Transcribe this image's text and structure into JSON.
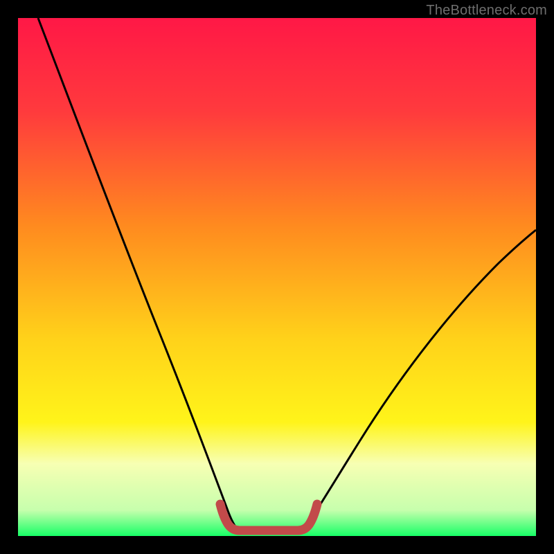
{
  "branding": {
    "watermark": "TheBottleneck.com"
  },
  "chart_data": {
    "type": "line",
    "title": "",
    "xlabel": "",
    "ylabel": "",
    "xlim": [
      0,
      100
    ],
    "ylim": [
      0,
      100
    ],
    "background_gradient": {
      "top": "#ff1846",
      "mid1": "#ff8a1f",
      "mid2": "#ffe51a",
      "band": "#f7ffb3",
      "bottom": "#17ff66"
    },
    "series": [
      {
        "name": "left-curve",
        "x": [
          4,
          8,
          12,
          16,
          20,
          24,
          28,
          32,
          36,
          40
        ],
        "values": [
          100,
          87,
          74,
          62,
          50,
          38,
          27,
          17,
          8,
          2
        ]
      },
      {
        "name": "right-curve",
        "x": [
          52,
          56,
          62,
          68,
          74,
          80,
          86,
          92,
          98,
          100
        ],
        "values": [
          2,
          7,
          14,
          22,
          30,
          38,
          45,
          52,
          58,
          60
        ]
      },
      {
        "name": "bracket",
        "x": [
          38.5,
          39.5,
          40.5,
          51.5,
          52.5,
          53.5
        ],
        "values": [
          5.5,
          2.5,
          1.5,
          1.5,
          2.5,
          5.5
        ]
      }
    ],
    "colors": {
      "curve": "#000000",
      "bracket": "#c24a4a"
    }
  }
}
